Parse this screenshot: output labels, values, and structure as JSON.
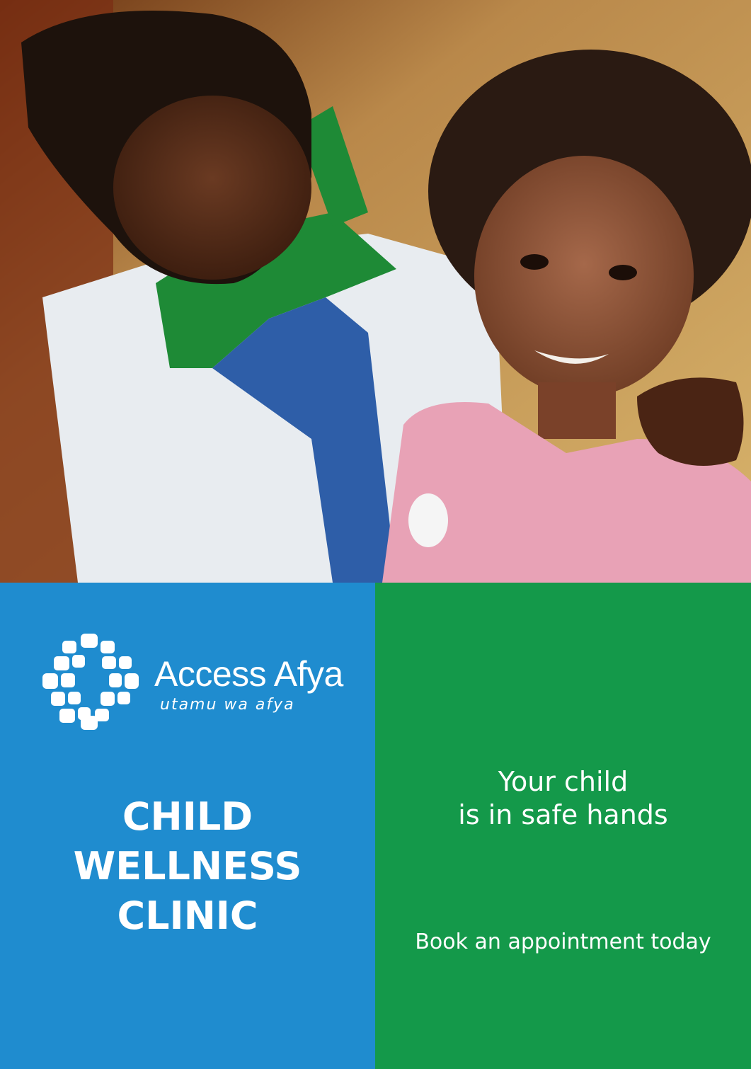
{
  "photo": {
    "alt": "Nurse with hand on smiling child's shoulder"
  },
  "logo": {
    "name": "Access Afya",
    "tagline": "utamu wa afya",
    "icon": "cross-of-tiles-icon"
  },
  "clinic": {
    "title_lines": [
      "CHILD",
      "WELLNESS",
      "CLINIC"
    ]
  },
  "message": {
    "tagline_lines": [
      "Your child",
      "is in safe hands"
    ],
    "cta": "Book an appointment today"
  },
  "colors": {
    "blue_panel": "#1f8ccf",
    "green_panel": "#14994a",
    "text": "#ffffff"
  }
}
